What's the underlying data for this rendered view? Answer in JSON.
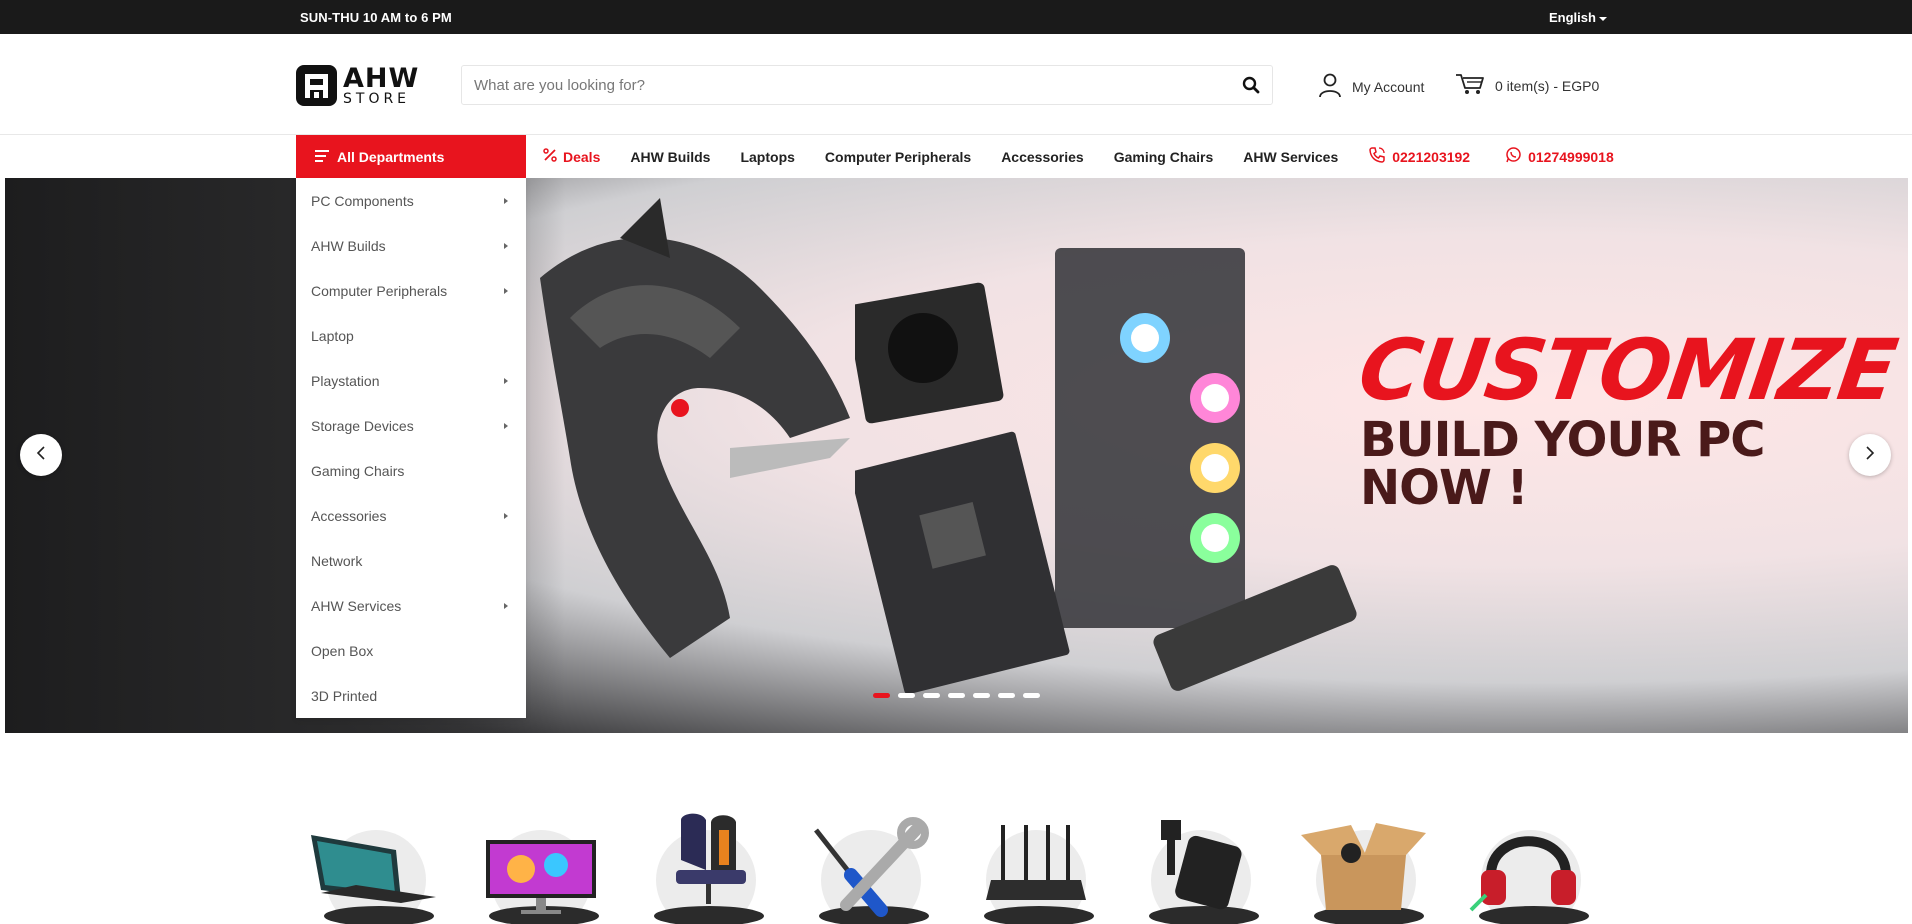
{
  "topbar": {
    "hours": "SUN-THU 10 AM to 6 PM",
    "language": "English"
  },
  "header": {
    "logo_line1": "AHW",
    "logo_line2": "STORE",
    "search_placeholder": "What are you looking for?",
    "account_label": "My Account",
    "cart_label": "0 item(s) - EGP0"
  },
  "nav": {
    "all_departments": "All Departments",
    "links": [
      {
        "label": "Deals"
      },
      {
        "label": "AHW Builds"
      },
      {
        "label": "Laptops"
      },
      {
        "label": "Computer Peripherals"
      },
      {
        "label": "Accessories"
      },
      {
        "label": "Gaming Chairs"
      },
      {
        "label": "AHW Services"
      }
    ],
    "phone": "0221203192",
    "whatsapp": "01274999018",
    "accent_color": "#e8141e"
  },
  "departments": [
    {
      "label": "PC Components",
      "has_submenu": true
    },
    {
      "label": "AHW Builds",
      "has_submenu": true
    },
    {
      "label": "Computer Peripherals",
      "has_submenu": true
    },
    {
      "label": "Laptop",
      "has_submenu": false
    },
    {
      "label": "Playstation",
      "has_submenu": true
    },
    {
      "label": "Storage Devices",
      "has_submenu": true
    },
    {
      "label": "Gaming Chairs",
      "has_submenu": false
    },
    {
      "label": "Accessories",
      "has_submenu": true
    },
    {
      "label": "Network",
      "has_submenu": false
    },
    {
      "label": "AHW Services",
      "has_submenu": true
    },
    {
      "label": "Open Box",
      "has_submenu": false
    },
    {
      "label": "3D Printed",
      "has_submenu": false
    }
  ],
  "hero": {
    "headline": "CUSTOMIZE",
    "subheadline": "BUILD YOUR PC NOW !",
    "slide_count": 7,
    "active_slide": 1
  },
  "categories": [
    {
      "icon": "laptop-icon"
    },
    {
      "icon": "monitor-icon"
    },
    {
      "icon": "gaming-chair-icon"
    },
    {
      "icon": "tools-icon"
    },
    {
      "icon": "router-icon"
    },
    {
      "icon": "phone-holder-icon"
    },
    {
      "icon": "open-box-icon"
    },
    {
      "icon": "headset-icon"
    }
  ]
}
